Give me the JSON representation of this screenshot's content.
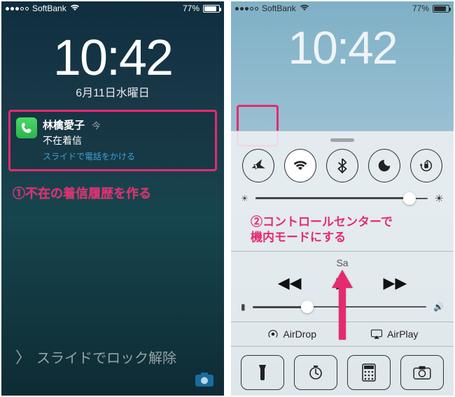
{
  "status": {
    "carrier": "SoftBank",
    "battery_pct": "77%"
  },
  "clock": {
    "time": "10:42",
    "date": "6月11日水曜日"
  },
  "notification": {
    "title": "林檎愛子",
    "when": "今",
    "subtitle": "不在着信",
    "hint": "スライドで電話をかける"
  },
  "annotations": {
    "left": "①不在の着信履歴を作る",
    "right_l1": "②コントロールセンターで",
    "right_l2": "機内モードにする"
  },
  "lockscreen": {
    "unlock_text": "スライドでロック解除"
  },
  "control_center": {
    "track_title": "Sa",
    "airdrop_label": "AirDrop",
    "airplay_label": "AirPlay"
  }
}
